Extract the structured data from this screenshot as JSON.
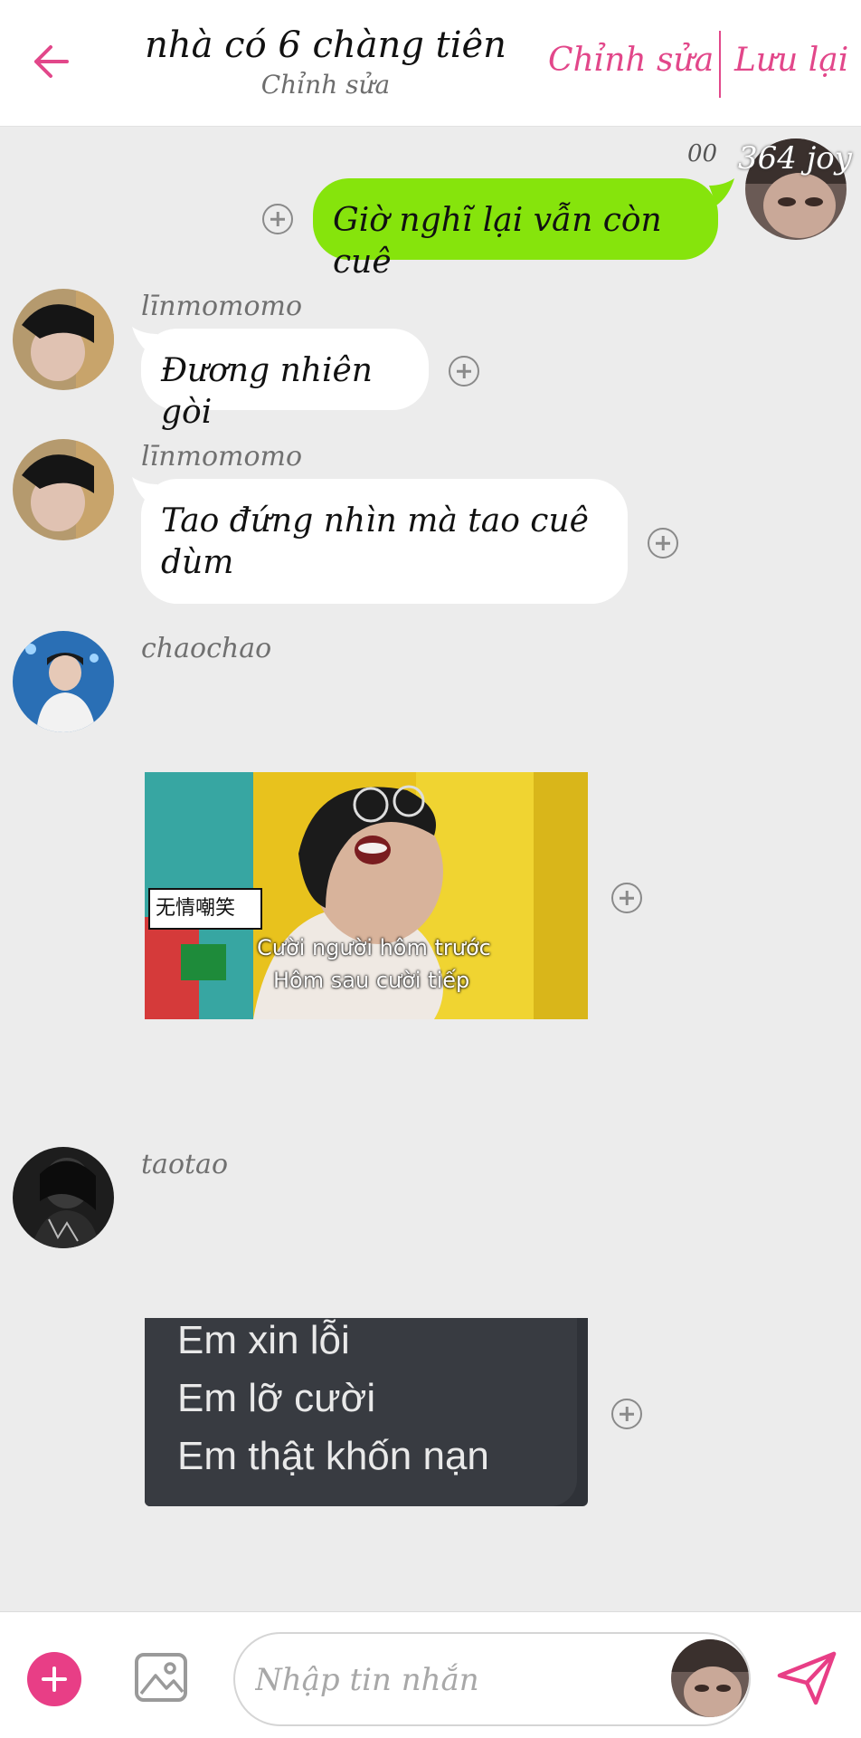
{
  "header": {
    "title": "nhà có 6 chàng tiên",
    "subtitle": "Chỉnh sửa",
    "edit_label": "Chỉnh sửa",
    "save_label": "Lưu lại",
    "accent_color": "#e2478a"
  },
  "messages": [
    {
      "sender": "364 joy",
      "direction": "outgoing",
      "time": "00",
      "text": "Giờ nghĩ lại vẫn còn cuê",
      "bubble_color": "#86e40c"
    },
    {
      "sender": "līnmomomo",
      "direction": "incoming",
      "text": "Đương nhiên gòi"
    },
    {
      "sender": "līnmomomo",
      "direction": "incoming",
      "text": "Tao đứng nhìn mà tao cuê dùm"
    },
    {
      "sender": "chaochao",
      "direction": "incoming",
      "type": "image",
      "image": {
        "tag": "无情嘲笑",
        "caption_line1": "Cười người hôm trước",
        "caption_line2": "Hôm sau cười tiếp"
      }
    },
    {
      "sender": "taotao",
      "direction": "incoming",
      "type": "image",
      "image": {
        "line1": "Em xin lỗi",
        "line2": "Em lỡ cười",
        "line3": "Em thật khốn nạn"
      }
    }
  ],
  "input": {
    "placeholder": "Nhập tin nhắn",
    "value": ""
  },
  "icons": {
    "back": "arrow-left-icon",
    "add": "plus-circle-icon",
    "image": "image-icon",
    "send": "send-icon",
    "react": "plus-circle-outline-icon"
  }
}
